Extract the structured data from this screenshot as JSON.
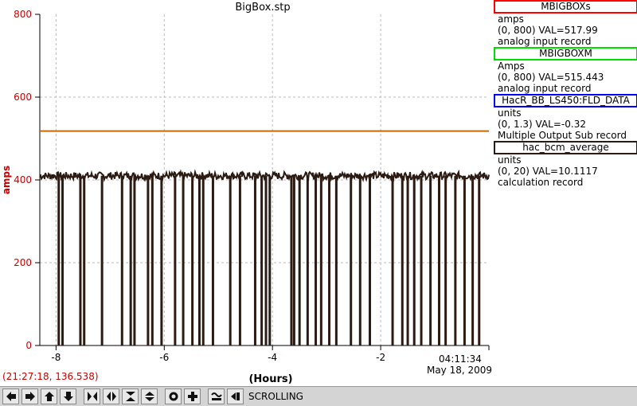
{
  "title": "BigBox.stp",
  "chart_data": {
    "type": "line",
    "ylabel": "amps",
    "xlabel": "(Hours)",
    "ylim": [
      0,
      800
    ],
    "xlim": [
      -8.3,
      0
    ],
    "y_ticks": [
      0,
      200,
      400,
      600,
      800
    ],
    "y_tick_labels": [
      "0",
      "200",
      "400",
      "600",
      "800"
    ],
    "x_ticks": [
      -8,
      -6,
      -4,
      -2
    ],
    "x_tick_labels": [
      "-8",
      "-6",
      "-4",
      "-2"
    ],
    "grid": true,
    "series": [
      {
        "name": "MBIGBOXs",
        "color": "#cc6600",
        "values_constant": 517.99
      },
      {
        "name": "hac_bcm_average",
        "color": "#2b1b12",
        "baseline": 410,
        "dropout_times": [
          -7.95,
          -7.88,
          -7.55,
          -7.48,
          -7.15,
          -6.78,
          -6.62,
          -6.55,
          -6.3,
          -6.22,
          -6.05,
          -5.8,
          -5.65,
          -5.48,
          -5.35,
          -5.28,
          -5.1,
          -4.78,
          -4.6,
          -4.32,
          -4.2,
          -4.12,
          -4.05,
          -3.65,
          -3.6,
          -3.5,
          -3.35,
          -3.2,
          -3.1,
          -2.95,
          -2.82,
          -2.55,
          -2.38,
          -2.2,
          -1.78,
          -1.6,
          -1.5,
          -1.38,
          -1.25,
          -1.08,
          -0.92,
          -0.8,
          -0.62,
          -0.45,
          -0.3,
          -0.18
        ],
        "dropout_value": 0
      }
    ]
  },
  "time": {
    "now": "04:11:34",
    "date": "May 18, 2009"
  },
  "cursor_readout": "(21:27:18, 136.538)",
  "legend": [
    {
      "name": "MBIGBOXs",
      "color": "#ff0000",
      "units": "amps",
      "range_val": "(0, 800)  VAL=517.99",
      "record": "analog input record"
    },
    {
      "name": "MBIGBOXM",
      "color": "#00dd00",
      "units": "Amps",
      "range_val": "(0, 800) VAL=515.443",
      "record": "analog input record"
    },
    {
      "name": "HacR_BB_LS450:FLD_DATA",
      "color": "#0000ff",
      "units": "units",
      "range_val": "(0, 1.3) VAL=-0.32",
      "record": "Multiple Output Sub record"
    },
    {
      "name": "hac_bcm_average",
      "color": "#2b1b12",
      "units": "units",
      "range_val": "(0, 20) VAL=10.1117",
      "record": "calculation record"
    }
  ],
  "toolbar": {
    "buttons": [
      "arrow-left-icon",
      "arrow-right-icon",
      "arrow-up-icon",
      "arrow-down-icon",
      "expand-horizontal-icon",
      "compress-horizontal-icon",
      "compress-vertical-icon",
      "expand-vertical-icon",
      "zoom-out-icon",
      "zoom-in-icon",
      "auto-scale-icon",
      "back-icon"
    ],
    "status": "SCROLLING"
  }
}
